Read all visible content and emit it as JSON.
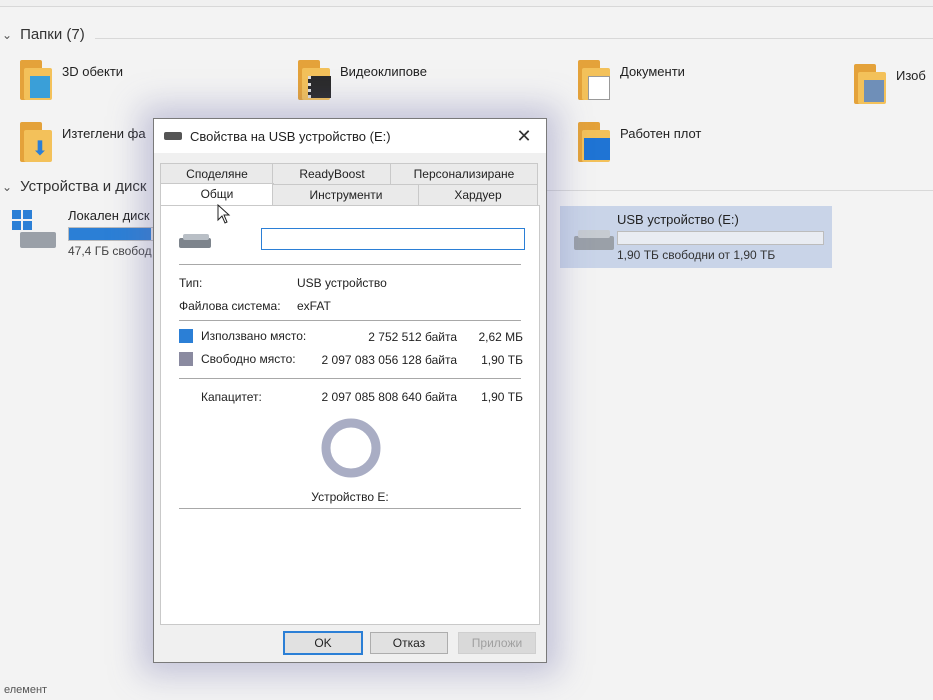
{
  "explorer": {
    "folders_header": "Папки (7)",
    "folders": [
      {
        "label": "3D обекти"
      },
      {
        "label": "Видеоклипове"
      },
      {
        "label": "Документи"
      },
      {
        "label": "Изоб"
      },
      {
        "label": "Изтеглени фа"
      },
      {
        "label": "Работен плот"
      }
    ],
    "devices_header": "Устройства и диск",
    "local_disk": {
      "label": "Локален диск",
      "free": "47,4 ГБ свобод",
      "used_fraction": 0.4
    },
    "usb_disk": {
      "label": "USB устройство (E:)",
      "free": "1,90 ТБ свободни от 1,90 ТБ",
      "used_fraction": 0.0
    },
    "status": "елемент"
  },
  "dialog": {
    "title": "Свойства на USB устройство (E:)",
    "tabs_top": [
      "Споделяне",
      "ReadyBoost",
      "Персонализиране"
    ],
    "tabs_bottom": [
      "Общи",
      "Инструменти",
      "Хардуер"
    ],
    "name_value": "",
    "type_label": "Тип:",
    "type_value": "USB устройство",
    "fs_label": "Файлова система:",
    "fs_value": "exFAT",
    "used_label": "Използвано място:",
    "used_bytes": "2 752 512 байта",
    "used_size": "2,62 МБ",
    "free_label": "Свободно място:",
    "free_bytes": "2 097 083 056 128 байта",
    "free_size": "1,90 ТБ",
    "capacity_label": "Капацитет:",
    "capacity_bytes": "2 097 085 808 640 байта",
    "capacity_size": "1,90 ТБ",
    "device_label": "Устройство E:",
    "used_fraction": 1.3e-06,
    "colors": {
      "used": "#2b7fd6",
      "free": "#8a8aa0"
    },
    "buttons": {
      "ok": "OK",
      "cancel": "Отказ",
      "apply": "Приложи"
    }
  }
}
